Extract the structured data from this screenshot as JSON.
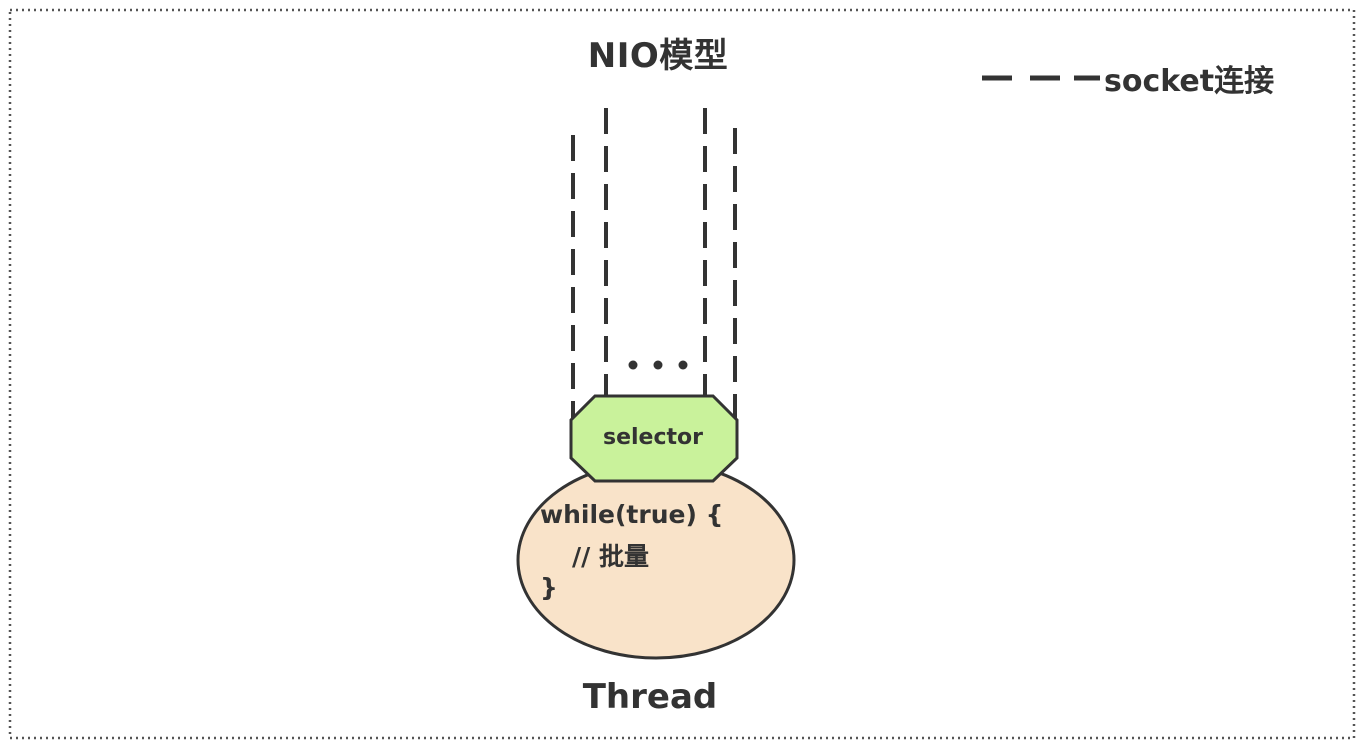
{
  "diagram": {
    "title": "NIO模型",
    "legend": {
      "label": "socket连接",
      "line_style": "dashed"
    },
    "ellipsis": "• • •",
    "selector": {
      "label": "selector",
      "color": "#c9f29b"
    },
    "thread": {
      "label": "Thread",
      "code_lines": [
        "while(true) {",
        "// 批量",
        "}"
      ],
      "color": "#f9e3c9"
    },
    "socket_connections_shown": 4,
    "border_style": "dotted"
  }
}
